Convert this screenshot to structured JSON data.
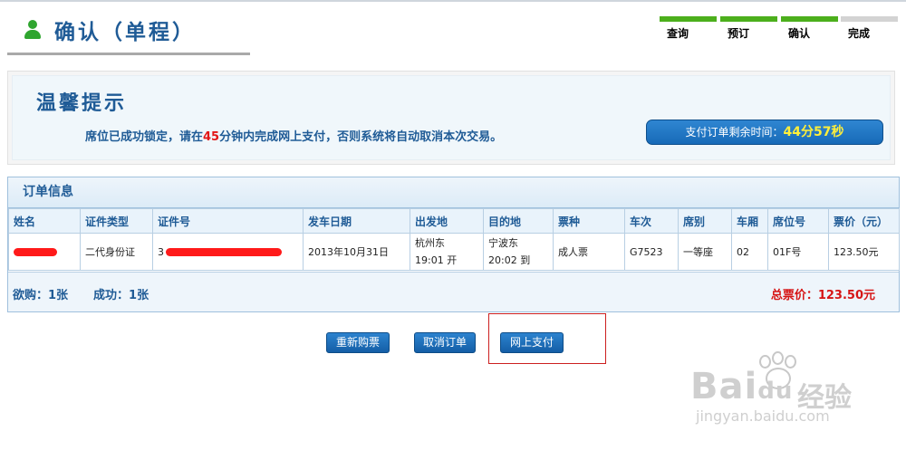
{
  "header": {
    "title": "确认（单程）",
    "steps": [
      {
        "label": "查询",
        "status": "done"
      },
      {
        "label": "预订",
        "status": "done"
      },
      {
        "label": "确认",
        "status": "done"
      },
      {
        "label": "完成",
        "status": "pending"
      }
    ]
  },
  "notice": {
    "title": "温馨提示",
    "msg_prefix": "席位已成功锁定，请在",
    "minutes": "45",
    "msg_suffix": "分钟内完成网上支付，否则系统将自动取消本次交易。",
    "timer_label": "支付订单剩余时间：",
    "timer_value": "44分57秒"
  },
  "order": {
    "title": "订单信息",
    "columns": [
      "姓名",
      "证件类型",
      "证件号",
      "发车日期",
      "出发地",
      "目的地",
      "票种",
      "车次",
      "席别",
      "车厢",
      "席位号",
      "票价（元）"
    ],
    "row": {
      "id_type": "二代身份证",
      "id_prefix": "3",
      "date": "2013年10月31日",
      "from_station": "杭州东",
      "depart_time": "19:01 开",
      "to_station": "宁波东",
      "arrive_time": "20:02 到",
      "ticket_type": "成人票",
      "train": "G7523",
      "seat_class": "一等座",
      "car": "02",
      "seat": "01F号",
      "price": "123.50元"
    },
    "wanted": "欲购：1张",
    "success": "成功：1张",
    "total": "总票价：123.50元"
  },
  "actions": {
    "rebuy": "重新购票",
    "cancel": "取消订单",
    "pay": "网上支付"
  },
  "colors": {
    "title_blue": "#1f5b96",
    "step_done": "#4caf1c",
    "step_pending": "#d3d3d3",
    "alert_red": "#e21616",
    "timer_value": "#ffef3a"
  },
  "watermark": {
    "brand": "Bai",
    "brand2": "du",
    "text": "经验",
    "url": "jingyan.baidu.com"
  }
}
